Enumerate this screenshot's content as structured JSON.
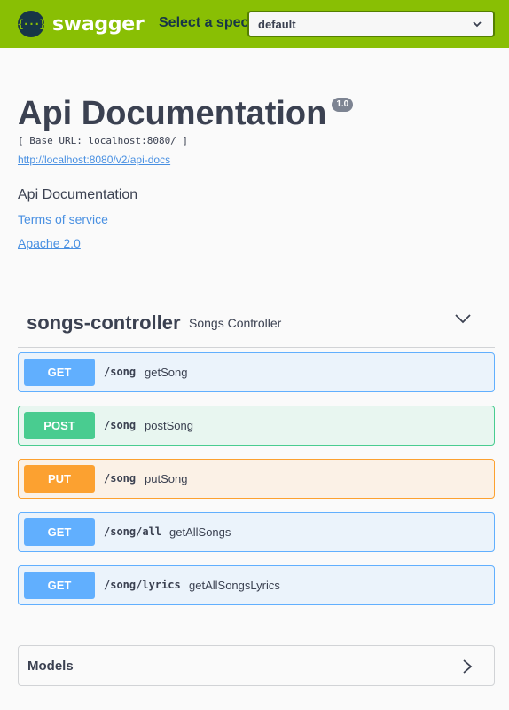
{
  "topbar": {
    "logo_glyph": "{···}",
    "logo_text": "swagger",
    "spec_label": "Select a spec",
    "spec_selected": "default",
    "brand_color": "#89bf04"
  },
  "info": {
    "title": "Api Documentation",
    "version": "1.0",
    "base_url": "[ Base URL: localhost:8080/ ]",
    "api_docs_link": "http://localhost:8080/v2/api-docs",
    "description": "Api Documentation",
    "terms_of_service": "Terms of service",
    "license": "Apache 2.0"
  },
  "tag": {
    "name": "songs-controller",
    "description": "Songs Controller"
  },
  "operations": [
    {
      "method": "GET",
      "path": "/song",
      "summary": "getSong"
    },
    {
      "method": "POST",
      "path": "/song",
      "summary": "postSong"
    },
    {
      "method": "PUT",
      "path": "/song",
      "summary": "putSong"
    },
    {
      "method": "GET",
      "path": "/song/all",
      "summary": "getAllSongs"
    },
    {
      "method": "GET",
      "path": "/song/lyrics",
      "summary": "getAllSongsLyrics"
    }
  ],
  "models": {
    "title": "Models"
  },
  "colors": {
    "get": "#61affe",
    "post": "#49cc90",
    "put": "#fca130",
    "link": "#4990e2"
  }
}
